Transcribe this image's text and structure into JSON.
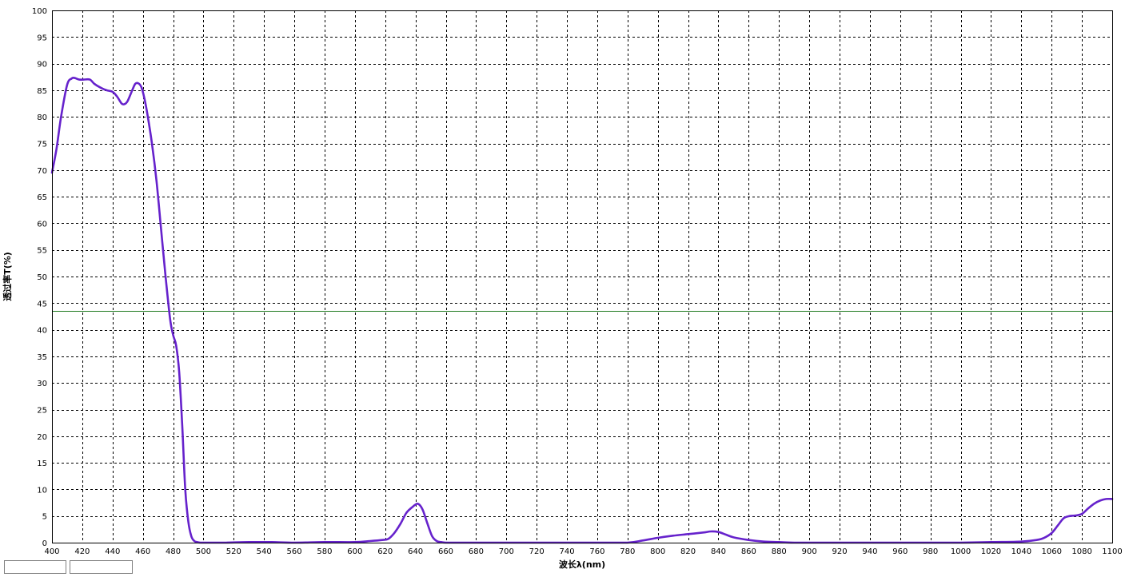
{
  "chart_data": {
    "type": "line",
    "title": "",
    "xlabel": "波长λ(nm)",
    "ylabel": "透过率T(%)",
    "xlim": [
      400,
      1100
    ],
    "ylim": [
      0,
      100
    ],
    "x_tick_step": 20,
    "y_tick_step": 5,
    "grid": true,
    "grid_style": "dashed",
    "colors": {
      "series": "#6622cc",
      "reference_line": "#1e7a1e",
      "grid": "#000000",
      "axis": "#000000"
    },
    "reference_line_y": 43.5,
    "series": [
      {
        "x": [
          400,
          403,
          406,
          410,
          413,
          415,
          418,
          421,
          425,
          428,
          432,
          436,
          440,
          443,
          446,
          448,
          450,
          453,
          455,
          457,
          459,
          461,
          463,
          466,
          469,
          472,
          475,
          478,
          480,
          482,
          484,
          486,
          488,
          490,
          492,
          494,
          496,
          498,
          500,
          503,
          508,
          515,
          530,
          545,
          560,
          580,
          600,
          610,
          618,
          622,
          626,
          630,
          634,
          638,
          641,
          643,
          645,
          648,
          651,
          654,
          657,
          660,
          670,
          700,
          760,
          780,
          790,
          800,
          810,
          820,
          830,
          835,
          840,
          845,
          850,
          860,
          870,
          880,
          890,
          920,
          960,
          1000,
          1020,
          1040,
          1050,
          1055,
          1060,
          1064,
          1068,
          1072,
          1076,
          1080,
          1084,
          1088,
          1092,
          1096,
          1100
        ],
        "y": [
          69.5,
          74,
          80,
          86,
          87.2,
          87.3,
          87,
          87,
          87,
          86.2,
          85.5,
          85,
          84.7,
          83.8,
          82.5,
          82.4,
          83,
          85,
          86.2,
          86.3,
          85.6,
          83.5,
          80.5,
          75,
          68,
          59,
          50,
          42,
          39,
          37,
          32,
          22,
          10,
          4,
          1.2,
          0.3,
          0.1,
          0,
          0,
          0,
          0,
          0,
          0.1,
          0.1,
          0,
          0.1,
          0.1,
          0.3,
          0.5,
          0.7,
          1.8,
          3.5,
          5.6,
          6.7,
          7.3,
          7.0,
          6.0,
          3.5,
          1.2,
          0.3,
          0.1,
          0,
          0,
          0,
          0,
          0,
          0.4,
          0.9,
          1.3,
          1.6,
          1.9,
          2.1,
          2.0,
          1.5,
          1.0,
          0.5,
          0.2,
          0.1,
          0,
          0,
          0,
          0,
          0.1,
          0.2,
          0.5,
          0.9,
          1.8,
          3.2,
          4.6,
          5.0,
          5.1,
          5.4,
          6.4,
          7.3,
          7.9,
          8.2,
          8.2
        ]
      }
    ]
  }
}
